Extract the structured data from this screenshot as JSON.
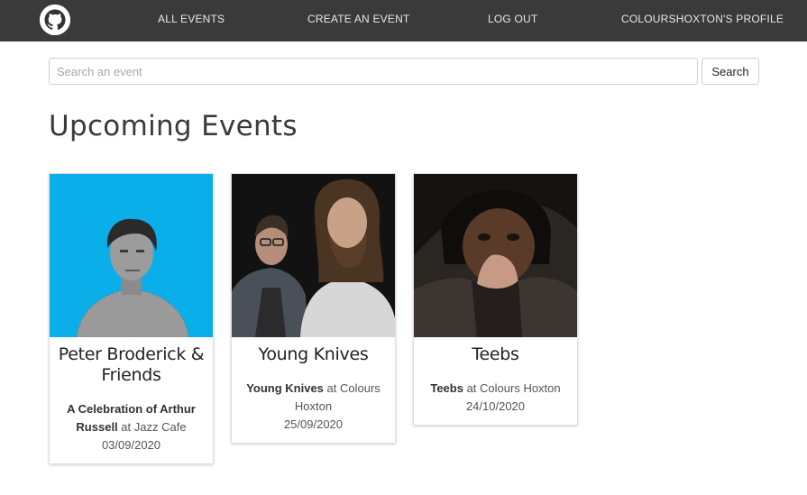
{
  "nav": {
    "links": [
      "ALL EVENTS",
      "CREATE AN EVENT",
      "LOG OUT",
      "COLOURSHOXTON'S PROFILE"
    ]
  },
  "search": {
    "placeholder": "Search an event",
    "value": "",
    "button_label": "Search"
  },
  "page": {
    "title": "Upcoming Events"
  },
  "events": [
    {
      "title": "Peter Broderick & Friends",
      "artist": "A Celebration of Arthur Russell",
      "venue_prefix": " at ",
      "venue": "Jazz Cafe",
      "date": "03/09/2020"
    },
    {
      "title": "Young Knives",
      "artist": "Young Knives",
      "venue_prefix": " at ",
      "venue": "Colours Hoxton",
      "date": "25/09/2020"
    },
    {
      "title": "Teebs",
      "artist": "Teebs",
      "venue_prefix": " at ",
      "venue": "Colours Hoxton",
      "date": "24/10/2020"
    }
  ],
  "colors": {
    "navbar": "#3a3a3a",
    "card1_bg": "#0aaee8",
    "card2_bg": "#121212",
    "card3_bg": "#2a2622"
  }
}
